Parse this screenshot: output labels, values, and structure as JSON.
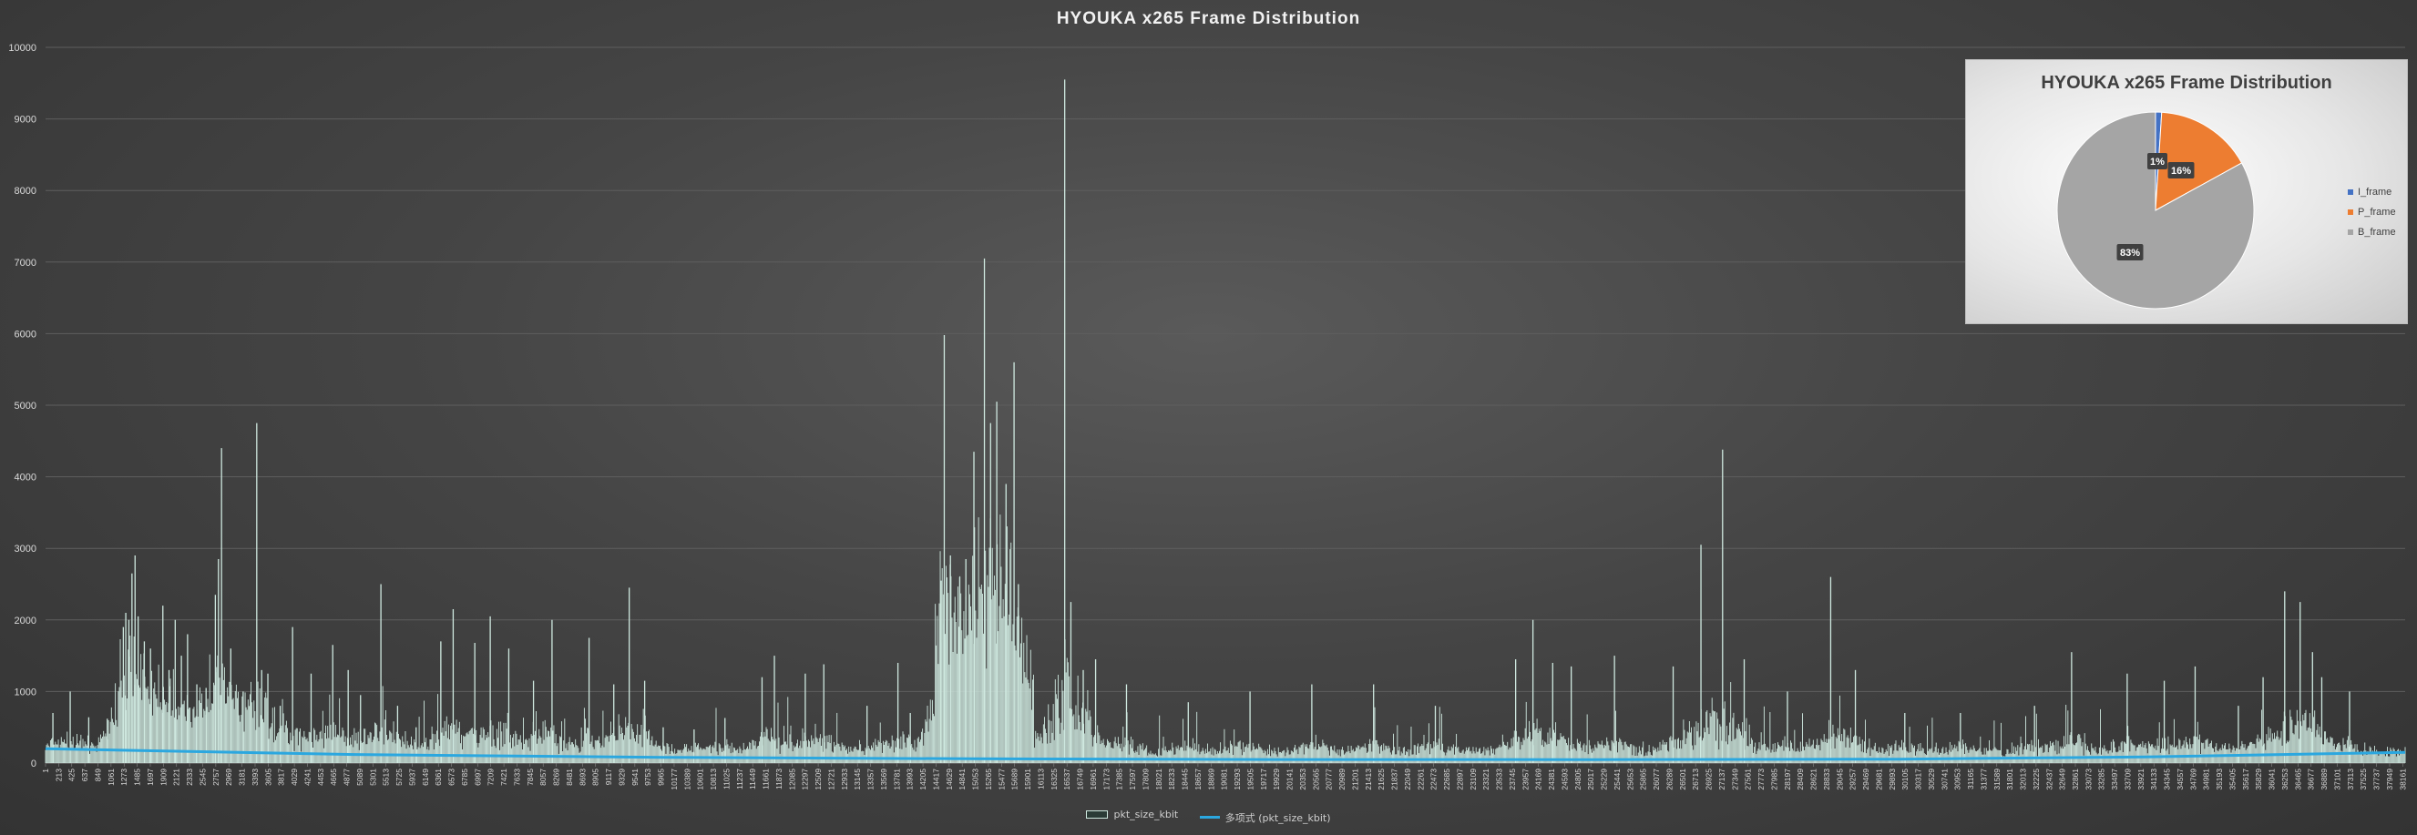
{
  "chart_data": [
    {
      "type": "bar",
      "title": "HYOUKA  x265 Frame Distribution",
      "ylim": [
        0,
        10000
      ],
      "yticks": [
        0,
        1000,
        2000,
        3000,
        4000,
        5000,
        6000,
        7000,
        8000,
        9000,
        10000
      ],
      "x_range": [
        1,
        38200
      ],
      "x_tick_step": 212,
      "grid": "horizontal",
      "legend_position": "bottom",
      "series": [
        {
          "name": "pkt_size_kbit",
          "style": "bar",
          "color": "#cfe9e0",
          "peaks": [
            [
              120,
              700
            ],
            [
              400,
              1000
            ],
            [
              700,
              640
            ],
            [
              1000,
              620
            ],
            [
              1260,
              1900
            ],
            [
              1300,
              2100
            ],
            [
              1350,
              2000
            ],
            [
              1400,
              2650
            ],
            [
              1450,
              2900
            ],
            [
              1500,
              2050
            ],
            [
              1600,
              1700
            ],
            [
              1700,
              1600
            ],
            [
              1800,
              900
            ],
            [
              1900,
              2200
            ],
            [
              2000,
              1300
            ],
            [
              2100,
              2000
            ],
            [
              2200,
              1500
            ],
            [
              2300,
              1800
            ],
            [
              2450,
              1100
            ],
            [
              2600,
              1050
            ],
            [
              2750,
              2350
            ],
            [
              2800,
              2850
            ],
            [
              2850,
              4400
            ],
            [
              3000,
              1600
            ],
            [
              3200,
              1000
            ],
            [
              3420,
              4750
            ],
            [
              3500,
              1300
            ],
            [
              3600,
              1250
            ],
            [
              3800,
              800
            ],
            [
              4000,
              1900
            ],
            [
              4300,
              1250
            ],
            [
              4650,
              1650
            ],
            [
              4900,
              1300
            ],
            [
              5100,
              950
            ],
            [
              5430,
              2500
            ],
            [
              5700,
              800
            ],
            [
              6000,
              500
            ],
            [
              6400,
              1700
            ],
            [
              6600,
              2150
            ],
            [
              6950,
              1680
            ],
            [
              7200,
              2050
            ],
            [
              7500,
              1600
            ],
            [
              7900,
              1150
            ],
            [
              8200,
              2000
            ],
            [
              8800,
              1750
            ],
            [
              9200,
              1100
            ],
            [
              9450,
              2450
            ],
            [
              9700,
              1150
            ],
            [
              10000,
              500
            ],
            [
              10500,
              470
            ],
            [
              11000,
              630
            ],
            [
              11600,
              1200
            ],
            [
              11800,
              1500
            ],
            [
              12300,
              1250
            ],
            [
              12600,
              1380
            ],
            [
              13300,
              800
            ],
            [
              13800,
              1400
            ],
            [
              14000,
              700
            ],
            [
              14500,
              2550
            ],
            [
              14550,
              5980
            ],
            [
              14650,
              2900
            ],
            [
              14800,
              2600
            ],
            [
              14900,
              2850
            ],
            [
              15030,
              4350
            ],
            [
              15200,
              7050
            ],
            [
              15300,
              4750
            ],
            [
              15400,
              5050
            ],
            [
              15550,
              3900
            ],
            [
              15680,
              5600
            ],
            [
              15750,
              2500
            ],
            [
              16500,
              9550
            ],
            [
              16600,
              2250
            ],
            [
              16800,
              1300
            ],
            [
              17000,
              1450
            ],
            [
              17500,
              1100
            ],
            [
              18500,
              850
            ],
            [
              19500,
              1000
            ],
            [
              20500,
              1100
            ],
            [
              21500,
              1100
            ],
            [
              22500,
              800
            ],
            [
              23800,
              1450
            ],
            [
              24080,
              2000
            ],
            [
              24400,
              1400
            ],
            [
              24700,
              1350
            ],
            [
              25400,
              1500
            ],
            [
              26350,
              1350
            ],
            [
              26800,
              3050
            ],
            [
              27150,
              4380
            ],
            [
              27500,
              1450
            ],
            [
              28200,
              1000
            ],
            [
              28900,
              2600
            ],
            [
              29300,
              1300
            ],
            [
              30100,
              700
            ],
            [
              31000,
              700
            ],
            [
              32200,
              800
            ],
            [
              32800,
              1550
            ],
            [
              33700,
              1250
            ],
            [
              34300,
              1150
            ],
            [
              34800,
              1350
            ],
            [
              35500,
              800
            ],
            [
              35900,
              1200
            ],
            [
              36250,
              2400
            ],
            [
              36500,
              2250
            ],
            [
              36700,
              1550
            ],
            [
              36850,
              1200
            ],
            [
              37300,
              1000
            ]
          ]
        },
        {
          "name": "多项式 (pkt_size_kbit)",
          "style": "line",
          "color": "#2ba7df",
          "points": [
            [
              1,
              200
            ],
            [
              5000,
              120
            ],
            [
              10000,
              80
            ],
            [
              15000,
              60
            ],
            [
              20000,
              50
            ],
            [
              25000,
              48
            ],
            [
              30000,
              55
            ],
            [
              34000,
              85
            ],
            [
              38200,
              150
            ]
          ]
        }
      ]
    },
    {
      "type": "pie",
      "title": "HYOUKA x265 Frame Distribution",
      "legend_position": "right",
      "labels": [
        "I_frame",
        "P_frame",
        "B_frame"
      ],
      "values": [
        1,
        16,
        83
      ],
      "data_labels": [
        "1%",
        "16%",
        "83%"
      ],
      "colors": [
        "#4472c4",
        "#ed7d31",
        "#a5a5a5"
      ]
    }
  ]
}
